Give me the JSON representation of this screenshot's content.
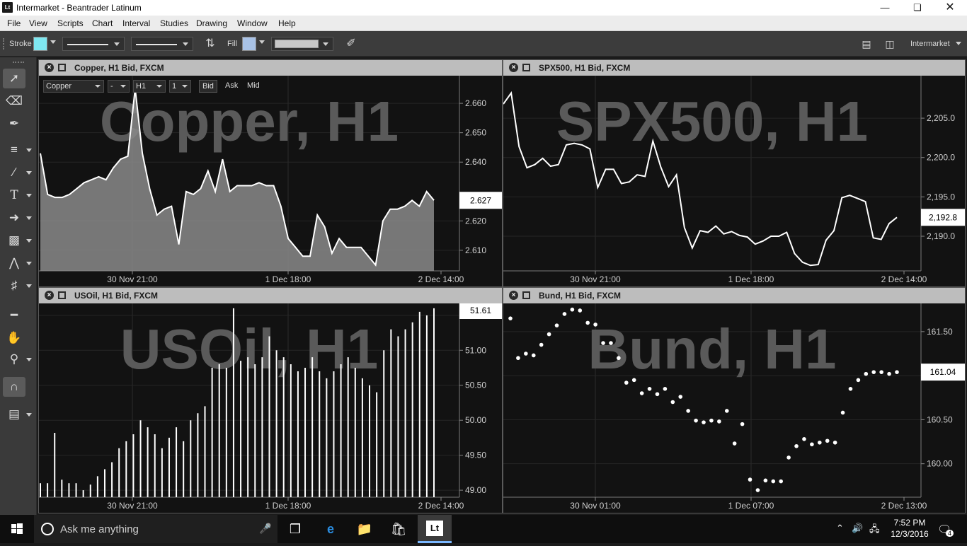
{
  "window": {
    "title": "Intermarket - Beantrader Latinum",
    "app_icon": "Lt"
  },
  "menu": [
    "File",
    "View",
    "Scripts",
    "Chart",
    "Interval",
    "Studies",
    "Drawing",
    "Window",
    "Help"
  ],
  "toolbar": {
    "stroke_label": "Stroke",
    "fill_label": "Fill",
    "stroke_color": "#7fe7f0",
    "fill_color": "#a8c2e6",
    "workspace": "Intermarket"
  },
  "copper_bar": {
    "symbol": "Copper",
    "dash": "-",
    "interval": "H1",
    "count": "1",
    "bid": "Bid",
    "ask": "Ask",
    "mid": "Mid"
  },
  "charts": {
    "copper": {
      "header": "Copper, H1 Bid, FXCM",
      "watermark": "Copper, H1",
      "price": "2.627",
      "x_labels": [
        "30 Nov 21:00",
        "1 Dec 18:00",
        "2 Dec 14:00"
      ],
      "y_labels": [
        "2.660",
        "2.650",
        "2.640",
        "2.620",
        "2.610"
      ]
    },
    "spx500": {
      "header": "SPX500, H1 Bid, FXCM",
      "watermark": "SPX500, H1",
      "price": "2,192.8",
      "x_labels": [
        "30 Nov 21:00",
        "1 Dec 18:00",
        "2 Dec 14:00"
      ],
      "y_labels": [
        "2,205.0",
        "2,200.0",
        "2,195.0",
        "2,190.0"
      ]
    },
    "usoil": {
      "header": "USOil, H1 Bid, FXCM",
      "watermark": "USOil, H1",
      "price": "51.61",
      "x_labels": [
        "30 Nov 21:00",
        "1 Dec 18:00",
        "2 Dec 14:00"
      ],
      "y_labels": [
        "51.50",
        "51.00",
        "50.50",
        "50.00",
        "49.50",
        "49.00"
      ]
    },
    "bund": {
      "header": "Bund, H1 Bid, FXCM",
      "watermark": "Bund, H1",
      "price": "161.04",
      "x_labels": [
        "30 Nov 01:00",
        "1 Dec 07:00",
        "2 Dec 13:00"
      ],
      "y_labels": [
        "161.50",
        "161.00",
        "160.50",
        "160.00"
      ]
    }
  },
  "chart_data": [
    {
      "type": "area",
      "title": "Copper, H1",
      "ylim": [
        2.603,
        2.667
      ],
      "series": [
        {
          "values": [
            2.643,
            2.629,
            2.628,
            2.628,
            2.629,
            2.631,
            2.633,
            2.634,
            2.635,
            2.634,
            2.638,
            2.641,
            2.642,
            2.665,
            2.643,
            2.631,
            2.622,
            2.624,
            2.625,
            2.612,
            2.63,
            2.629,
            2.631,
            2.637,
            2.63,
            2.641,
            2.63,
            2.632,
            2.632,
            2.632,
            2.633,
            2.632,
            2.632,
            2.625,
            2.614,
            2.611,
            2.608,
            2.608,
            2.622,
            2.618,
            2.609,
            2.614,
            2.611,
            2.611,
            2.611,
            2.608,
            2.605,
            2.62,
            2.624,
            2.624,
            2.625,
            2.627,
            2.625,
            2.63,
            2.627
          ]
        }
      ]
    },
    {
      "type": "line",
      "title": "SPX500, H1",
      "ylim": [
        2185.6,
        2209.5
      ],
      "series": [
        {
          "values": [
            2206.8,
            2208.2,
            2201.4,
            2198.7,
            2199.1,
            2199.9,
            2198.9,
            2199.1,
            2201.6,
            2201.8,
            2201.6,
            2201.1,
            2196.2,
            2198.5,
            2198.5,
            2196.7,
            2196.9,
            2197.8,
            2197.6,
            2202.1,
            2198.8,
            2196.3,
            2197.8,
            2191.1,
            2188.5,
            2190.7,
            2190.5,
            2191.3,
            2190.3,
            2190.6,
            2190.1,
            2189.9,
            2189.0,
            2189.4,
            2190.0,
            2190.0,
            2190.5,
            2187.8,
            2186.7,
            2186.3,
            2186.4,
            2189.5,
            2190.7,
            2194.9,
            2195.2,
            2194.8,
            2194.4,
            2189.8,
            2189.6,
            2191.6,
            2192.4
          ]
        }
      ]
    },
    {
      "type": "bar",
      "title": "USOil, H1",
      "ylim": [
        48.9,
        51.67
      ],
      "series": [
        {
          "values": [
            49.1,
            49.1,
            49.82,
            49.15,
            49.1,
            49.1,
            49.0,
            49.08,
            49.2,
            49.3,
            49.4,
            49.6,
            49.7,
            49.8,
            50.0,
            49.9,
            49.8,
            49.6,
            49.75,
            49.9,
            49.7,
            50.0,
            50.1,
            50.2,
            50.75,
            50.8,
            50.75,
            51.6,
            50.85,
            50.9,
            50.8,
            50.9,
            51.2,
            51.0,
            50.9,
            50.8,
            50.7,
            50.75,
            50.9,
            50.7,
            50.6,
            50.7,
            50.8,
            50.9,
            50.75,
            50.6,
            50.5,
            50.4,
            51.0,
            51.3,
            51.2,
            51.3,
            51.4,
            51.55,
            51.5,
            51.6
          ]
        }
      ]
    },
    {
      "type": "scatter",
      "title": "Bund, H1",
      "ylim": [
        159.62,
        161.82
      ],
      "series": [
        {
          "values": [
            161.65,
            161.2,
            161.25,
            161.23,
            161.35,
            161.47,
            161.57,
            161.7,
            161.75,
            161.74,
            161.6,
            161.58,
            161.37,
            161.37,
            161.2,
            160.92,
            160.95,
            160.8,
            160.85,
            160.79,
            160.85,
            160.7,
            160.76,
            160.6,
            160.49,
            160.47,
            160.49,
            160.48,
            160.6,
            160.23,
            160.45,
            159.82,
            159.7,
            159.81,
            159.8,
            159.8,
            160.07,
            160.2,
            160.28,
            160.22,
            160.24,
            160.26,
            160.24,
            160.58,
            160.85,
            160.95,
            161.02,
            161.04,
            161.04,
            161.02,
            161.04
          ]
        }
      ]
    }
  ],
  "taskbar": {
    "search_placeholder": "Ask me anything",
    "time": "7:52 PM",
    "date": "12/3/2016",
    "notifications": "4"
  }
}
